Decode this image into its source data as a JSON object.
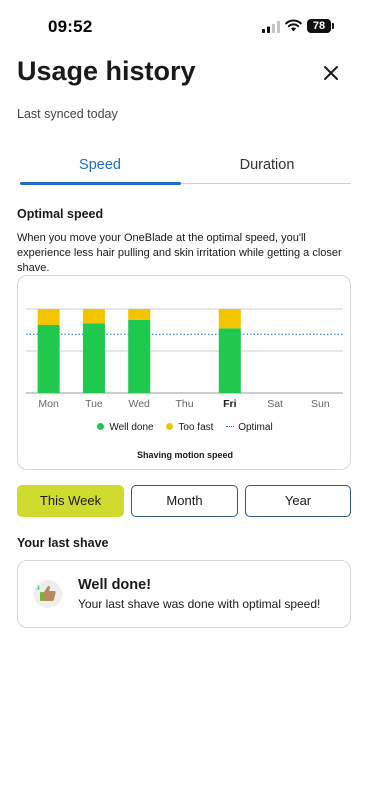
{
  "status_bar": {
    "time": "09:52",
    "battery": "78"
  },
  "header": {
    "title": "Usage history",
    "subtitle": "Last synced today"
  },
  "tabs": [
    {
      "label": "Speed",
      "active": true
    },
    {
      "label": "Duration",
      "active": false
    }
  ],
  "section": {
    "heading": "Optimal speed",
    "description": "When you move your OneBlade at the optimal speed, you'll experience less hair pulling and skin irritation while getting a closer shave."
  },
  "chart_data": {
    "type": "bar",
    "stacked": true,
    "categories": [
      "Mon",
      "Tue",
      "Wed",
      "Thu",
      "Fri",
      "Sat",
      "Sun"
    ],
    "highlighted_category": "Fri",
    "series": [
      {
        "name": "Well done",
        "color": "#1ec94e",
        "values": [
          0.81,
          0.83,
          0.87,
          0,
          0.77,
          0,
          0
        ]
      },
      {
        "name": "Too fast",
        "color": "#f2c500",
        "values": [
          0.19,
          0.17,
          0.13,
          0,
          0.23,
          0,
          0
        ]
      }
    ],
    "reference_line": {
      "name": "Optimal",
      "value": 0.7,
      "color": "#1f6fc0",
      "style": "dotted"
    },
    "ylim": [
      0,
      1
    ],
    "caption": "Shaving motion speed",
    "legend_position": "bottom"
  },
  "period_buttons": [
    {
      "label": "This Week",
      "selected": true
    },
    {
      "label": "Month",
      "selected": false
    },
    {
      "label": "Year",
      "selected": false
    }
  ],
  "last_shave": {
    "heading": "Your last shave",
    "title": "Well done!",
    "message": "Your last shave was done with optimal speed!",
    "icon": "thumbs-up-icon"
  }
}
